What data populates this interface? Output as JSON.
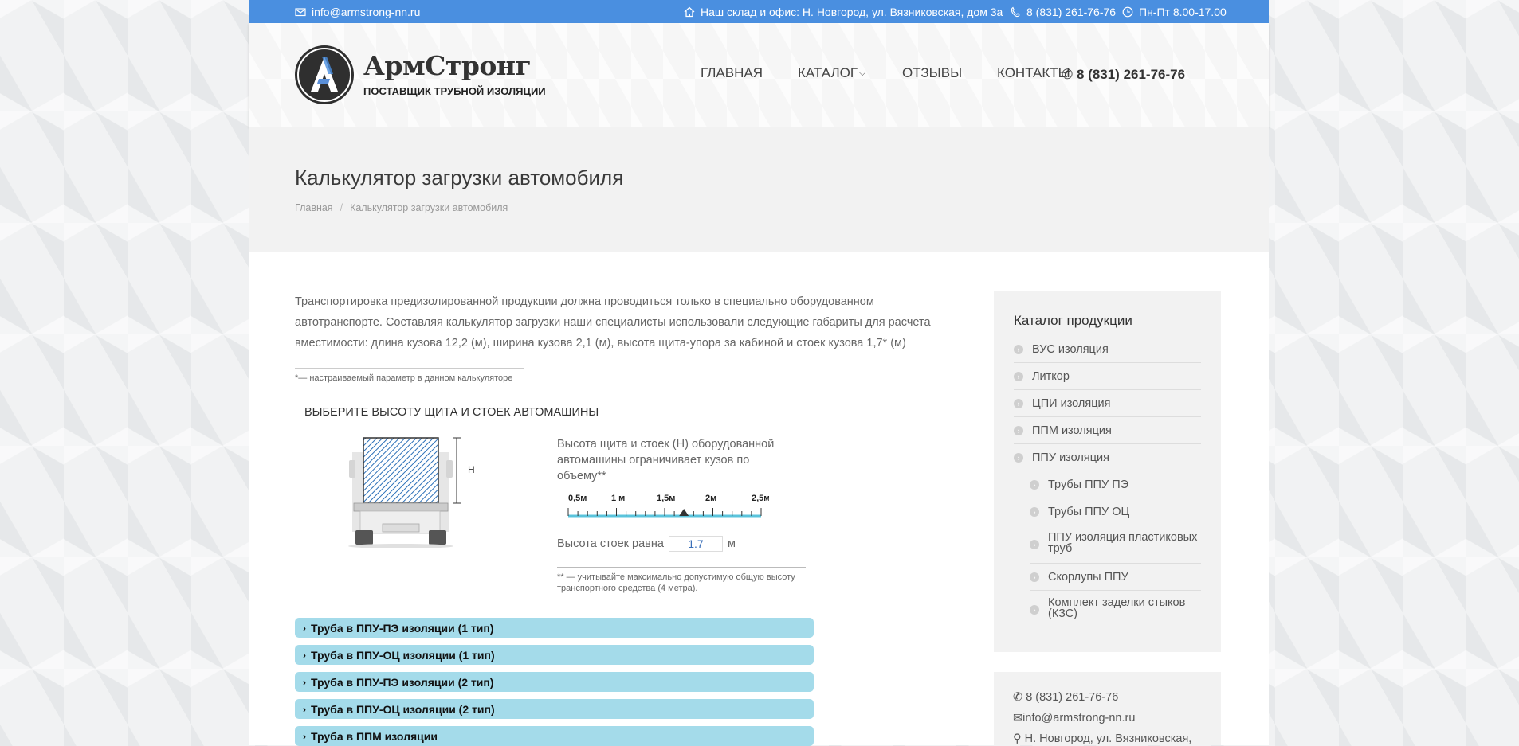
{
  "topbar": {
    "email": "info@armstrong-nn.ru",
    "address": "Наш склад и офис: Н. Новгород, ул. Вязниковская, дом 3а",
    "phone": "8 (831) 261-76-76",
    "hours": "Пн-Пт 8.00-17.00"
  },
  "logo": {
    "name": "АрмСтронг",
    "tagline": "ПОСТАВЩИК ТРУБНОЙ ИЗОЛЯЦИИ"
  },
  "nav": {
    "home": "ГЛАВНАЯ",
    "catalog": "КАТАЛОГ",
    "reviews": "ОТЗЫВЫ",
    "contacts": "КОНТАКТЫ"
  },
  "header_phone": "8 (831) 261-76-76",
  "page": {
    "title": "Калькулятор загрузки автомобиля",
    "breadcrumb": [
      "Главная",
      "Калькулятор загрузки автомобиля"
    ]
  },
  "intro": "Транспортировка предизолированной продукции должна проводиться только в специально оборудованном автотранспорте. Составляя калькулятор загрузки наши специалисты использовали следующие габариты для расчета вместимости: длина кузова 12,2 (м), ширина кузова 2,1 (м), высота щита-упора за кабиной и стоек кузова 1,7* (м)",
  "note": "*— настраиваемый параметр в данном калькуляторе",
  "calculator": {
    "title": "ВЫБЕРИТЕ ВЫСОТУ ЩИТА И СТОЕК АВТОМАШИНЫ",
    "h_label": "H",
    "description": "Высота щита и стоек (H) оборудованной автомашины ограничивает кузов по объему**",
    "scale_labels": [
      "0,5м",
      "1 м",
      "1,5м",
      "2м",
      "2,5м"
    ],
    "height_label": "Высота стоек равна",
    "height_value": "1.7",
    "unit": "м",
    "height_fraction": 0.6,
    "note": "** — учитывайте максимально допустимую общую высоту транспортного средства (4 метра)."
  },
  "accordion": [
    "Труба в ППУ-ПЭ изоляции (1 тип)",
    "Труба в ППУ-ОЦ изоляции (1 тип)",
    "Труба в ППУ-ПЭ изоляции (2 тип)",
    "Труба в ППУ-ОЦ изоляции (2 тип)",
    "Труба в ППМ изоляции"
  ],
  "sidebar": {
    "title": "Каталог продукции",
    "items": [
      "ВУС изоляция",
      "Литкор",
      "ЦПИ изоляция",
      "ППМ изоляция",
      "ППУ изоляция"
    ],
    "subitems": [
      "Трубы ППУ ПЭ",
      "Трубы ППУ ОЦ",
      "ППУ изоляция пластиковых труб",
      "Скорлупы ППУ",
      "Комплект заделки стыков (КЗС)"
    ]
  },
  "contacts": {
    "phone": "8 (831) 261-76-76",
    "email": "info@armstrong-nn.ru",
    "address": "Н. Новгород, ул. Вязниковская,"
  },
  "colors": {
    "topbar": "#4a8fe0",
    "accordion": "#a4dbea",
    "scale": "#5bc4dc"
  }
}
